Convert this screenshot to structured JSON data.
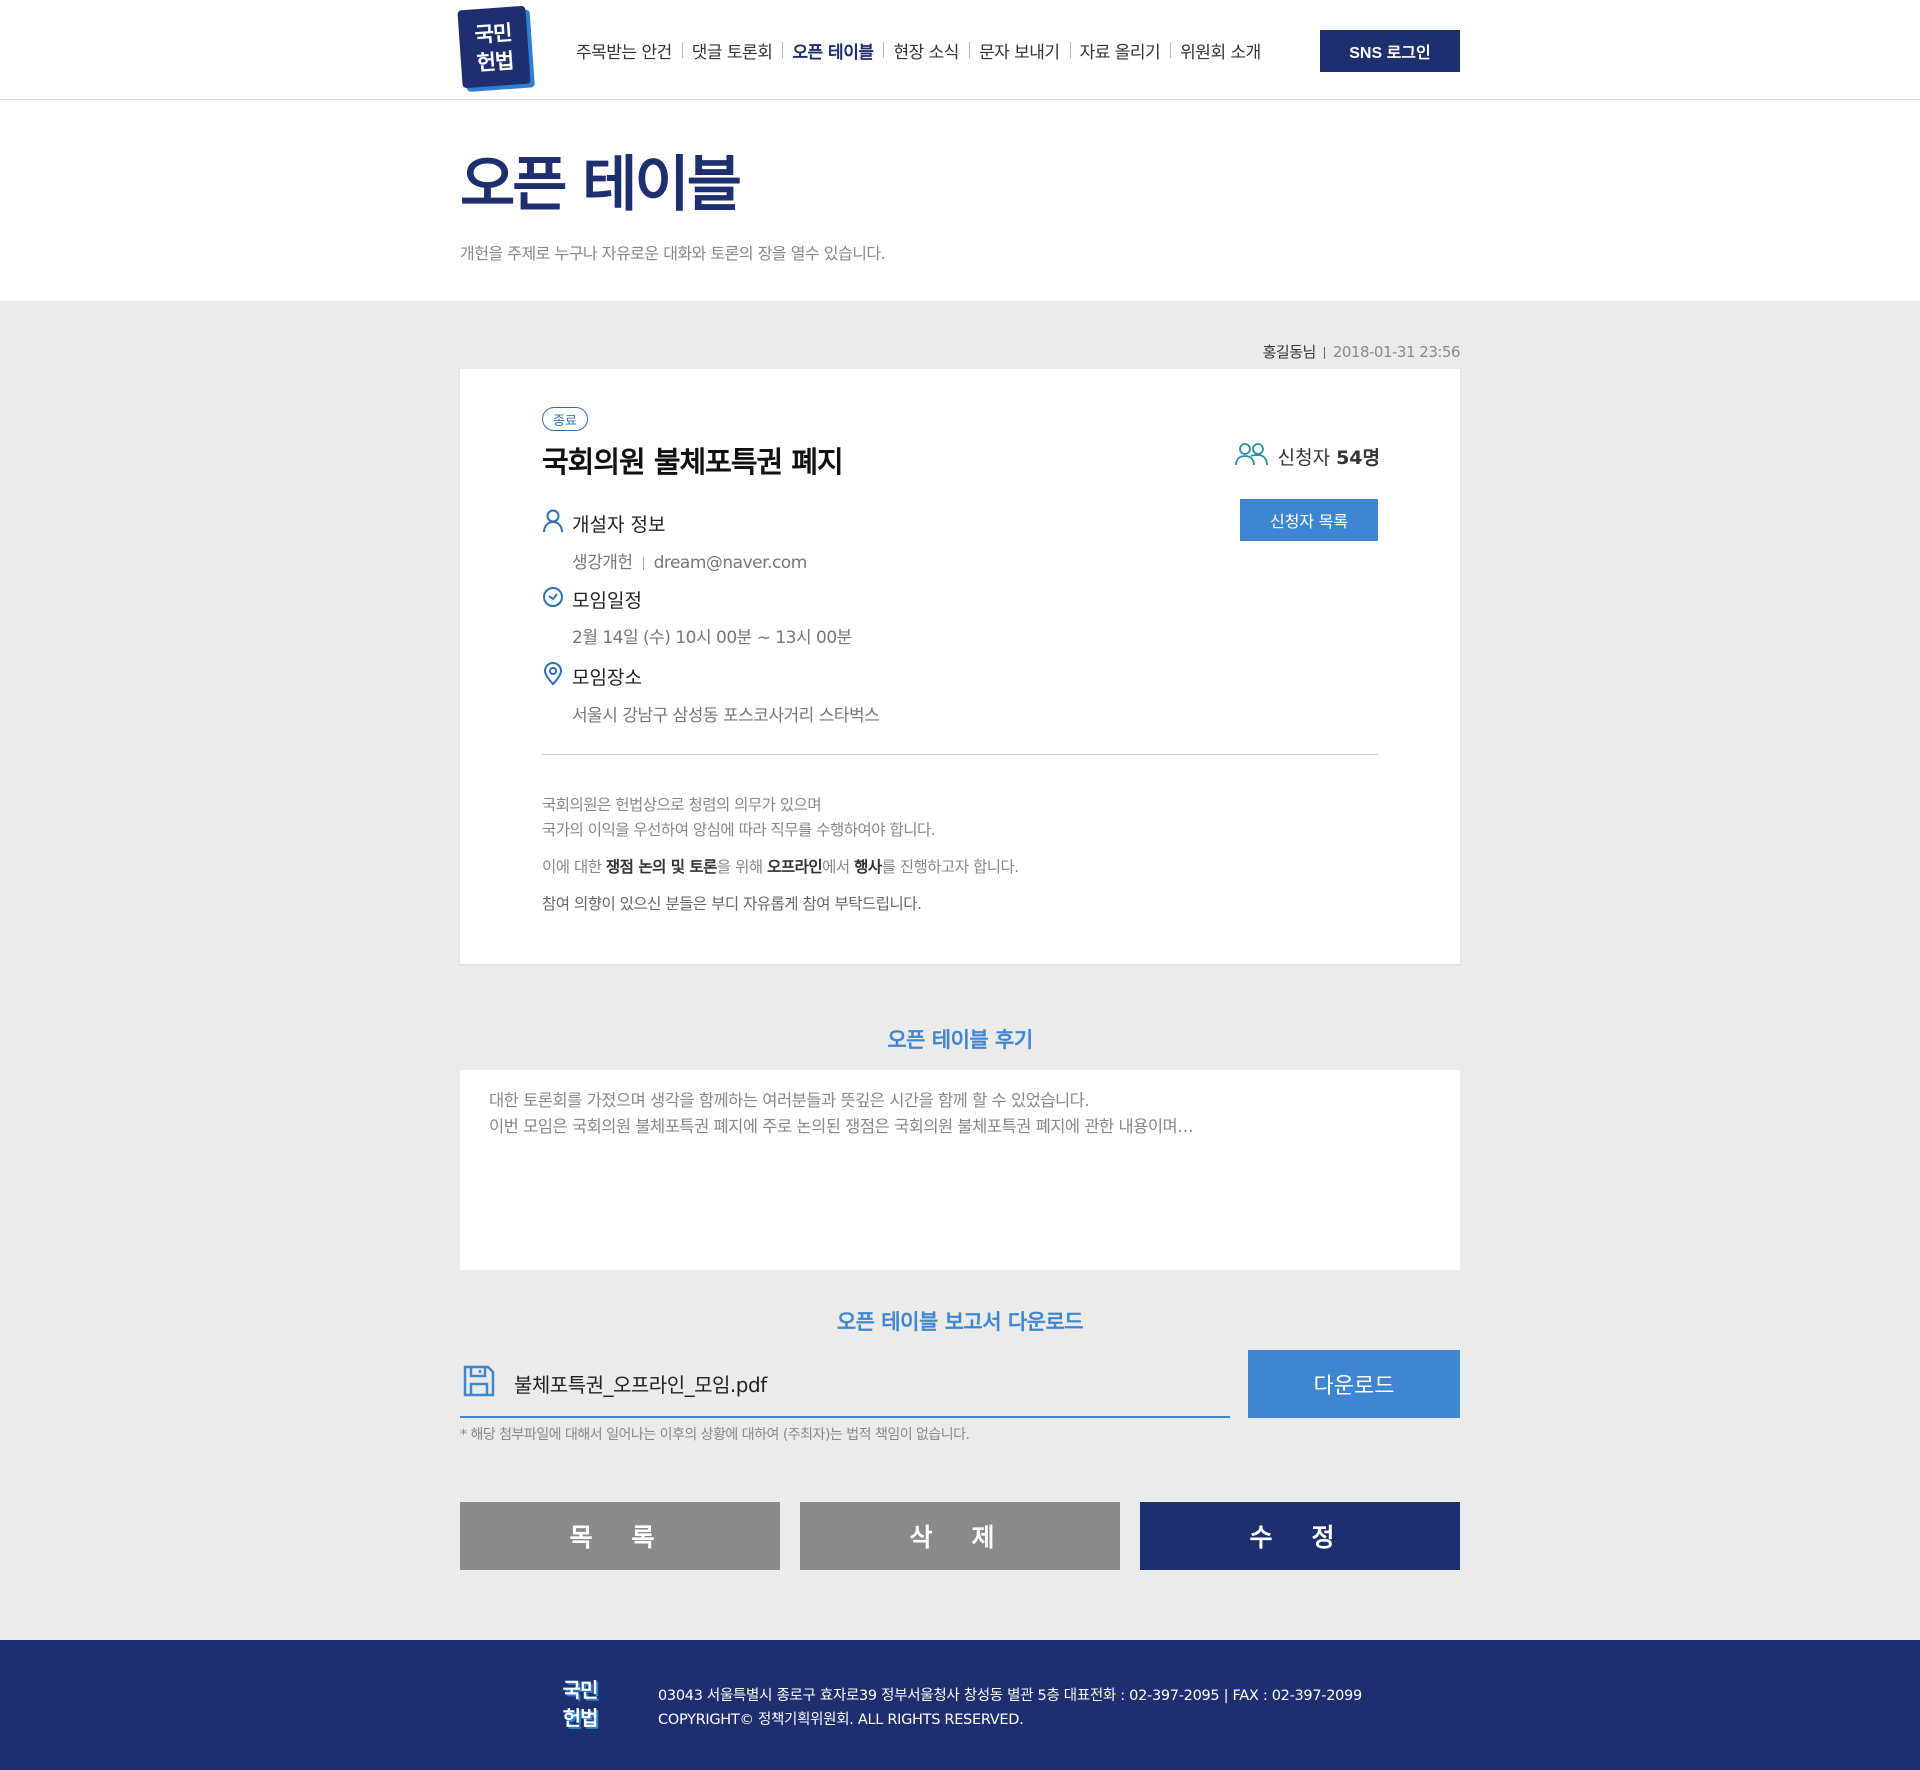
{
  "header": {
    "logo_line1": "국민",
    "logo_line2": "헌법",
    "nav": [
      {
        "label": "주목받는 안건",
        "active": false
      },
      {
        "label": "댓글 토론회",
        "active": false
      },
      {
        "label": "오픈 테이블",
        "active": true
      },
      {
        "label": "현장 소식",
        "active": false
      },
      {
        "label": "문자 보내기",
        "active": false
      },
      {
        "label": "자료 올리기",
        "active": false
      },
      {
        "label": "위원회 소개",
        "active": false
      }
    ],
    "sns_login": "SNS 로그인"
  },
  "title_area": {
    "title": "오픈 테이블",
    "subtitle": "개헌을 주제로 누구나 자유로운 대화와 토론의 장을 열수 있습니다."
  },
  "post": {
    "author": "홍길동님",
    "date": "2018-01-31 23:56",
    "status": "종료",
    "title": "국회의원 불체포특권 폐지",
    "applicants_label": "신청자",
    "applicants_count": "54명",
    "applicants_list_button": "신청자 목록",
    "organizer": {
      "label": "개설자 정보",
      "name": "생강개헌",
      "email": "dream@naver.com"
    },
    "schedule": {
      "label": "모임일정",
      "value": "2월 14일 (수) 10시 00분 ~ 13시 00분"
    },
    "place": {
      "label": "모임장소",
      "value": "서울시 강남구 삼성동 포스코사거리 스타벅스"
    },
    "description": {
      "line1": "국회의원은 헌법상으로 청렴의 의무가 있으며",
      "line2": "국가의 이익을 우선하여 양심에 따라 직무를 수행하여야 합니다.",
      "line3_pre": "이에 대한 ",
      "line3_b1": "쟁점 논의 및 토론",
      "line3_mid1": "을 위해 ",
      "line3_b2": "오프라인",
      "line3_mid2": "에서 ",
      "line3_b3": "행사",
      "line3_post": "를 진행하고자 합니다.",
      "line4": "참여 의향이 있으신 분들은 부디 자유롭게 참여 부탁드립니다."
    }
  },
  "review": {
    "title": "오픈 테이블 후기",
    "line1": "대한 토론회를 가졌으며 생각을 함께하는 여러분들과  뜻깊은 시간을 함께 할 수 있었습니다.",
    "line2": "이번 모임은 국회의원 불체포특권 폐지에 주로 논의된 쟁점은 국회의원 불체포특권 폐지에 관한 내용이며…"
  },
  "report": {
    "title": "오픈 테이블 보고서 다운로드",
    "file_name": "불체포특권_오프라인_모임.pdf",
    "download_button": "다운로드",
    "notice": "* 해당 첨부파일에 대해서 일어나는 이후의 상황에 대하여 (주최자)는 법적 책임이 없습니다."
  },
  "actions": {
    "list": "목 록",
    "delete": "삭 제",
    "edit": "수 정"
  },
  "footer": {
    "logo_line1": "국민",
    "logo_line2": "헌법",
    "address": "03043 서울특별시 종로구 효자로39 정부서울청사 창성동 별관 5층 대표전화 : 02-397-2095 | FAX : 02-397-2099",
    "copyright": "COPYRIGHT© 정책기획위원회. ALL RIGHTS RESERVED."
  },
  "colors": {
    "navy": "#1d2f6e",
    "accent_blue": "#3f86d0",
    "grey_button": "#8a8a8a",
    "background_grey": "#ebebeb"
  }
}
